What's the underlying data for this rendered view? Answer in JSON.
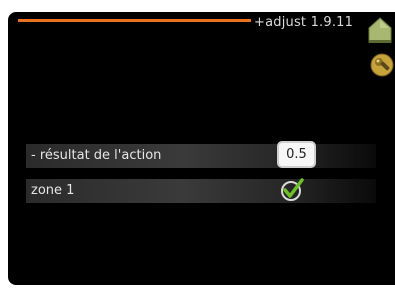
{
  "header": {
    "title": "+adjust 1.9.11",
    "accent_color": "#e8741f",
    "icons": [
      "home-icon",
      "wrench-icon"
    ]
  },
  "rows": [
    {
      "label": "- résultat de l'action",
      "value": "0.5"
    },
    {
      "label": "zone 1",
      "checked": true,
      "icon": "check-icon"
    }
  ]
}
